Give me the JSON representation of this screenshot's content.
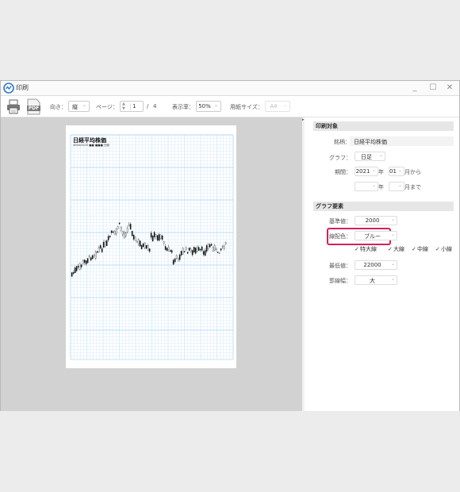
{
  "window": {
    "title": "印刷",
    "controls": {
      "minimize": "_",
      "maximize": "☐",
      "close": "✕"
    }
  },
  "toolbar": {
    "print_icon": "printer-icon",
    "pdf_label": "PDF",
    "orientation_label": "向き：",
    "orientation_value": "縦",
    "page_label": "ページ：",
    "page_current": "1",
    "page_separator": "/",
    "page_total": "4",
    "zoom_label": "表示率：",
    "zoom_value": "50%",
    "paper_label": "用紙サイズ：",
    "paper_value": "A4"
  },
  "preview": {
    "chart_title": "日経平均株価",
    "chart_subtitle": "4000/3220 ■■ ■■■ 日経"
  },
  "print_target": {
    "header": "印刷対象",
    "symbol_label": "銘柄：",
    "symbol_value": "日経平均株価",
    "graph_label": "グラフ：",
    "graph_value": "日足",
    "period_label": "期間：",
    "from_year": "2021",
    "year_suffix": "年",
    "from_month": "01",
    "from_suffix": "月から",
    "to_year": "",
    "to_month": "",
    "to_suffix": "月まで"
  },
  "graph_elements": {
    "header": "グラフ要素",
    "base_label": "基準値：",
    "base_value": "2000",
    "line_color_label": "線配色：",
    "line_color_value": "ブルー",
    "lines": [
      {
        "label": "特大線",
        "checked": true
      },
      {
        "label": "大線",
        "checked": true
      },
      {
        "label": "中線",
        "checked": true
      },
      {
        "label": "小線",
        "checked": true
      }
    ],
    "min_label": "最低値：",
    "min_value": "22000",
    "ruled_label": "罫線幅：",
    "ruled_value": "大"
  },
  "colors": {
    "highlight": "#d6205b",
    "grid": "#cfe6f8",
    "grid_major": "#a8d2f0"
  }
}
